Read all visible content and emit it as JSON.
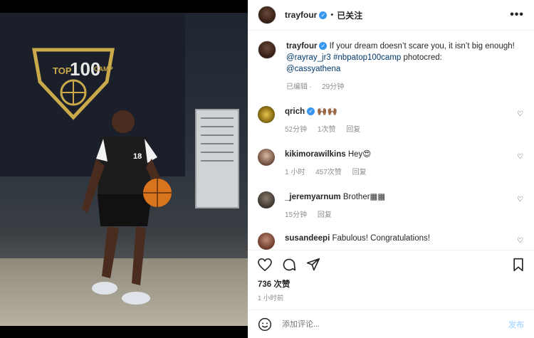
{
  "header": {
    "username": "trayfour",
    "separator": "•",
    "follow_label": "已关注",
    "more_label": "•••"
  },
  "photo": {
    "logo_top": "TOP",
    "logo_number": "100",
    "logo_bottom": "CAMP",
    "jersey_number": "18"
  },
  "caption": {
    "username": "trayfour",
    "text_before": "If your dream doesn’t scare you, it isn’t big enough! ",
    "mention": "@rayray_jr3",
    "hashtag": "#nbpatop100camp",
    "text_mid": " photocred: ",
    "mention2": "@cassyathena",
    "edited": "已编辑",
    "time": "29分钟"
  },
  "comments": [
    {
      "username": "qrich",
      "text": "🙌🏾🙌🏾",
      "time": "52分钟",
      "likes": "1次赞",
      "reply": "回复"
    },
    {
      "username": "kikimorawilkins",
      "text": "Hey😍",
      "time": "1 小时",
      "likes": "457次赞",
      "reply": "回复"
    },
    {
      "username": "_jeremyarnum",
      "text": "Brother▦▦",
      "time": "15分钟",
      "reply": "回复"
    },
    {
      "username": "susandeepi",
      "text": "Fabulous! Congratulations!"
    }
  ],
  "post_stats": {
    "likes": "736 次赞",
    "time": "1 小时前"
  },
  "add_comment": {
    "placeholder": "添加评论...",
    "post_label": "发布"
  }
}
